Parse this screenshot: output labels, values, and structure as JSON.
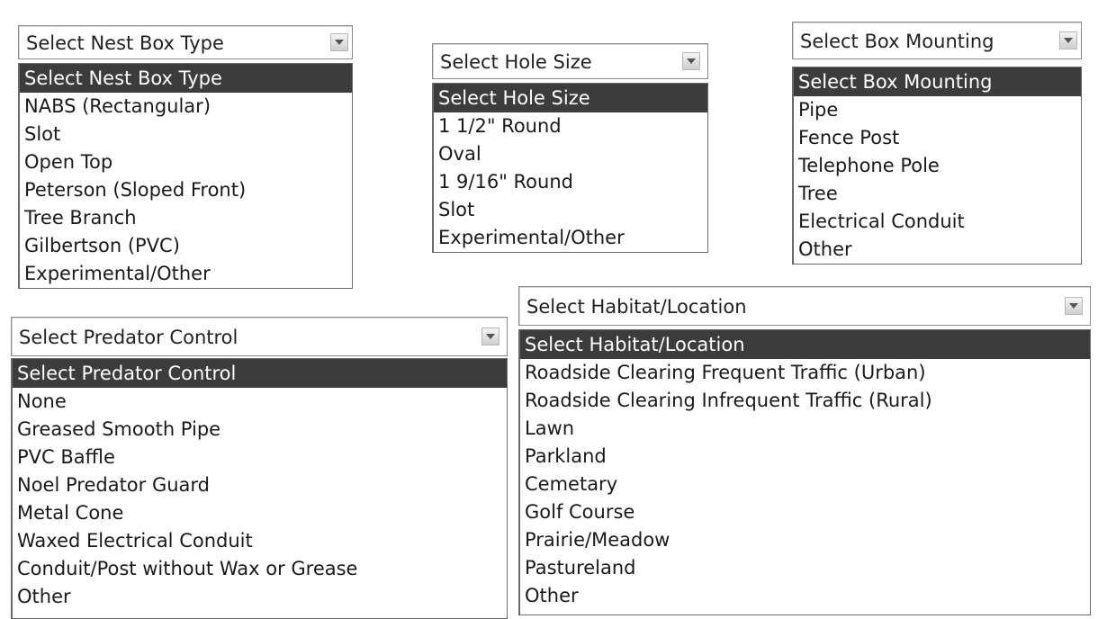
{
  "nest_box_type": {
    "selected": "Select Nest Box Type",
    "options": [
      "Select Nest Box Type",
      "NABS (Rectangular)",
      "Slot",
      "Open Top",
      "Peterson (Sloped Front)",
      "Tree Branch",
      "Gilbertson (PVC)",
      "Experimental/Other"
    ]
  },
  "hole_size": {
    "selected": "Select Hole Size",
    "options": [
      "Select Hole Size",
      "1 1/2\" Round",
      "Oval",
      "1 9/16\" Round",
      "Slot",
      "Experimental/Other"
    ]
  },
  "box_mounting": {
    "selected": "Select Box Mounting",
    "options": [
      "Select Box Mounting",
      "Pipe",
      "Fence Post",
      "Telephone Pole",
      "Tree",
      "Electrical Conduit",
      "Other"
    ]
  },
  "predator_control": {
    "selected": "Select Predator Control",
    "options": [
      "Select Predator Control",
      "None",
      "Greased Smooth Pipe",
      "PVC Baffle",
      "Noel Predator Guard",
      "Metal Cone",
      "Waxed Electrical Conduit",
      "Conduit/Post without Wax or Grease",
      "Other"
    ]
  },
  "habitat_location": {
    "selected": "Select Habitat/Location",
    "options": [
      "Select Habitat/Location",
      "Roadside Clearing Frequent Traffic (Urban)",
      "Roadside Clearing Infrequent Traffic (Rural)",
      "Lawn",
      "Parkland",
      "Cemetary",
      "Golf Course",
      "Prairie/Meadow",
      "Pastureland",
      "Other"
    ]
  },
  "colors": {
    "highlight": "#3c3c3c",
    "highlight_text": "#ffffff",
    "border": "#6a6a6a"
  },
  "icons": {
    "dropdown_arrow": "chevron-down-icon"
  }
}
